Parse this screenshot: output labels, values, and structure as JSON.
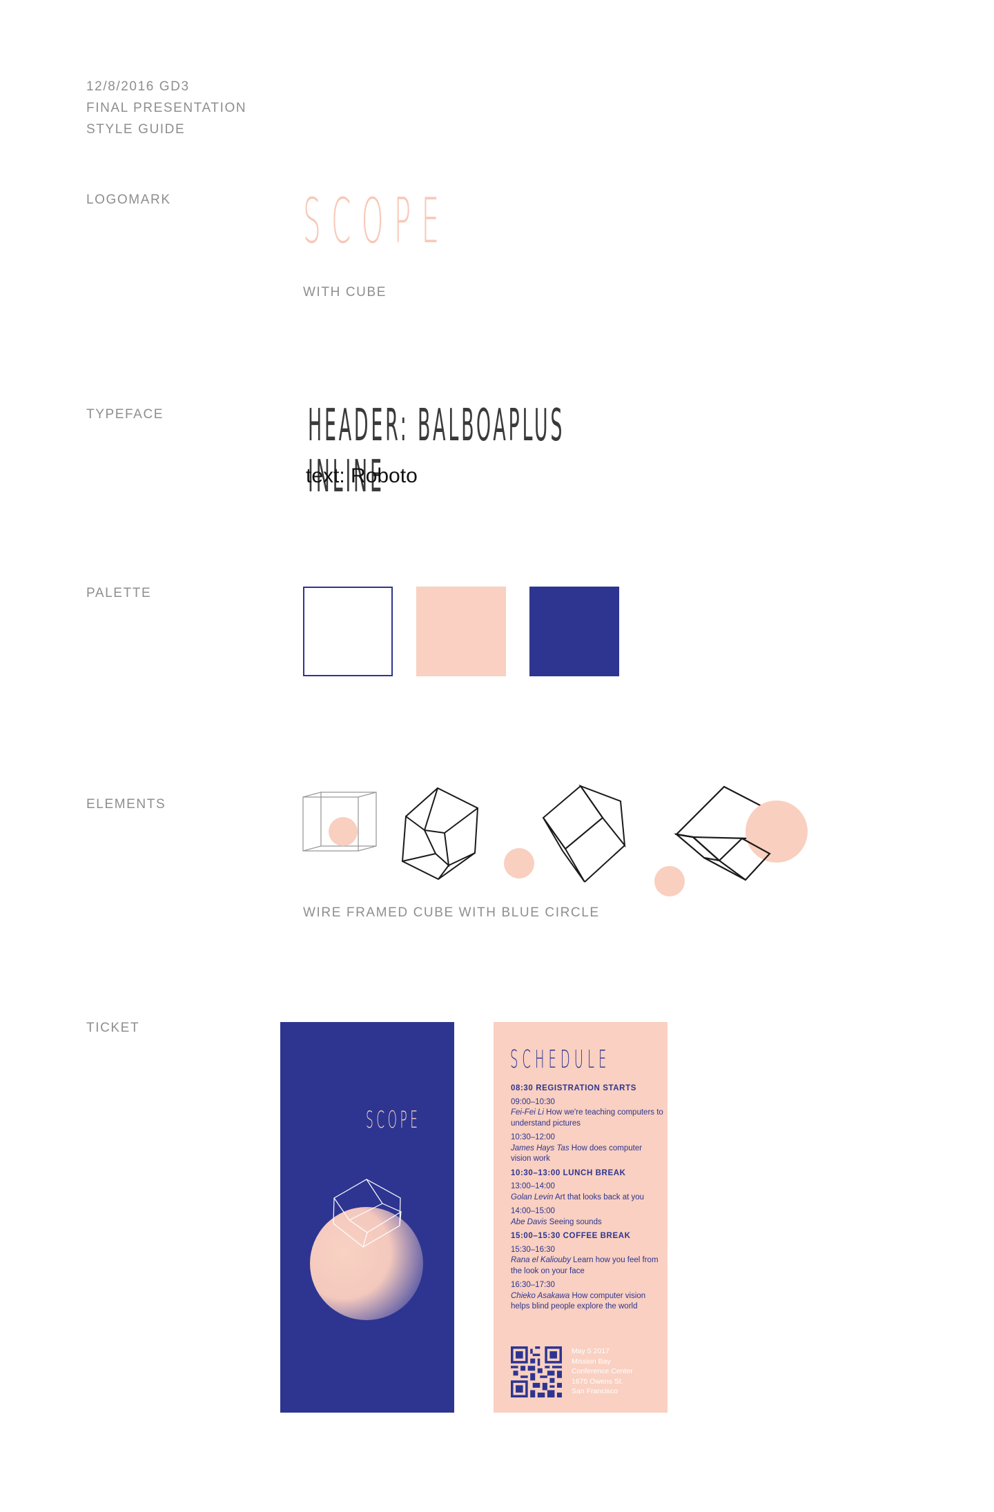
{
  "header": {
    "line1": "12/8/2016 GD3",
    "line2": "FINAL PRESENTATION",
    "line3": "STYLE GUIDE"
  },
  "sections": {
    "logomark": {
      "label": "LOGOMARK",
      "logo_text": "SCOPE",
      "caption": "WITH CUBE"
    },
    "typeface": {
      "label": "TYPEFACE",
      "header_sample": "HEADER: BALBOAPLUS INLINE",
      "text_sample": "text: Roboto"
    },
    "palette": {
      "label": "PALETTE",
      "colors": [
        "#ffffff",
        "#f9d0c1",
        "#2d3590"
      ]
    },
    "elements": {
      "label": "ELEMENTS",
      "caption": "WIRE FRAMED CUBE WITH BLUE CIRCLE"
    },
    "ticket": {
      "label": "TICKET"
    }
  },
  "ticket": {
    "front_title": "SCOPE",
    "schedule_title": "SCHEDULE",
    "schedule": {
      "reg": "08:30  REGISTRATION STARTS",
      "s1_time": "09:00–10:30",
      "s1_name": "Fei-Fei Li",
      "s1_talk": "How we're teaching computers to understand pictures",
      "s2_time": "10:30–12:00",
      "s2_name": "James Hays Tas",
      "s2_talk": "How does computer vision work",
      "lunch": "10:30–13:00  LUNCH BREAK",
      "s3_time": "13:00–14:00",
      "s3_name": "Golan Levin",
      "s3_talk": "Art that looks back at you",
      "s4_time": "14:00–15:00",
      "s4_name": "Abe Davis",
      "s4_talk": "Seeing sounds",
      "coffee": "15:00–15:30  COFFEE BREAK",
      "s5_time": "15:30–16:30",
      "s5_name": "Rana el Kaliouby",
      "s5_talk": "Learn how you feel from the look on your face",
      "s6_time": "16:30–17:30",
      "s6_name": "Chieko Asakawa",
      "s6_talk": "How computer vision helps blind people explore the world"
    },
    "venue": {
      "date": "May 5 2017",
      "line1": "Mission Bay",
      "line2": "Conference Center",
      "line3": "1675 Owens St.",
      "line4": "San Francisco"
    }
  },
  "colors": {
    "navy": "#2d3590",
    "peach": "#f9d0c1",
    "gray_text": "#8e8e8e"
  }
}
